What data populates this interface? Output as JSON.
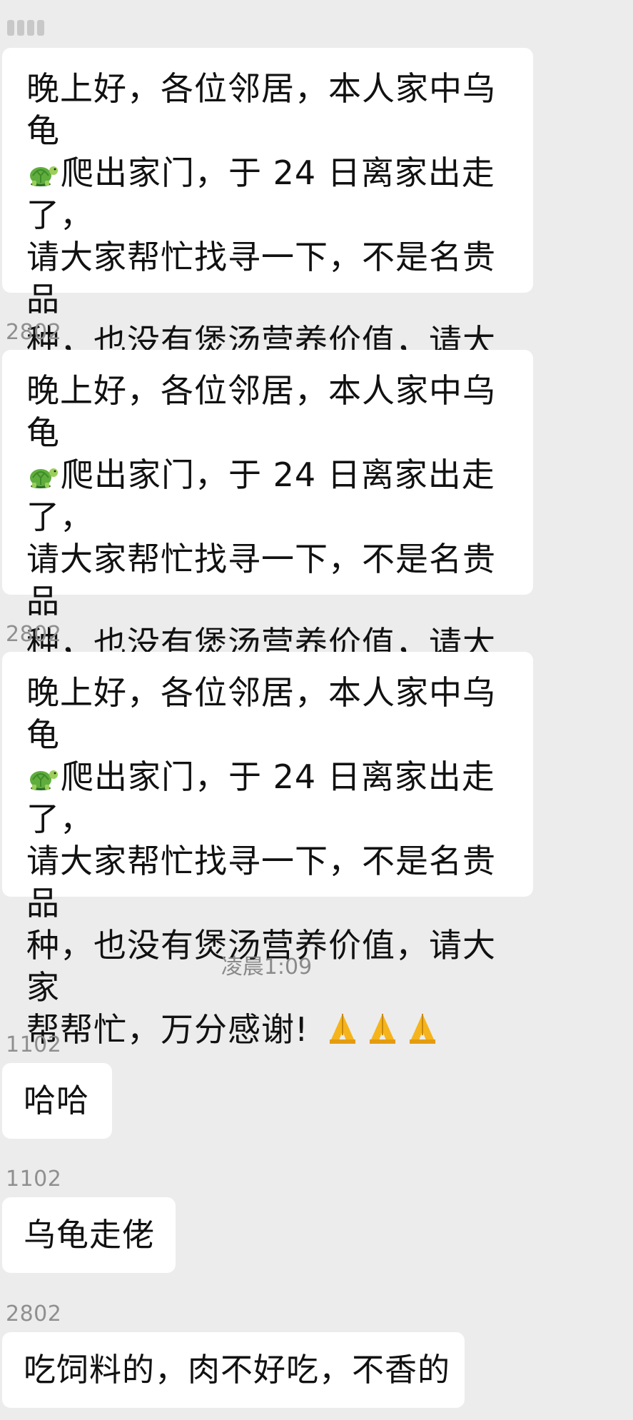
{
  "messages": [
    {
      "sender": "",
      "text_before_turtle": "晚上好，各位邻居，本人家中乌龟\n",
      "turtle_icon": "turtle-icon",
      "text_after_turtle": "爬出家门，于 24 日离家出走了，\n请大家帮忙找寻一下，不是名贵品\n种，也没有煲汤营养价值，请大家\n帮帮忙，万分感谢!",
      "trailing_icons": [
        "pray-icon",
        "pray-icon",
        "pray-icon"
      ]
    },
    {
      "sender": "2802",
      "text_before_turtle": "晚上好，各位邻居，本人家中乌龟\n",
      "turtle_icon": "turtle-icon",
      "text_after_turtle": "爬出家门，于 24 日离家出走了，\n请大家帮忙找寻一下，不是名贵品\n种，也没有煲汤营养价值，请大家\n帮帮忙，万分感谢!",
      "trailing_icons": [
        "pray-icon",
        "pray-icon",
        "pray-icon"
      ]
    },
    {
      "sender": "2802",
      "text_before_turtle": "晚上好，各位邻居，本人家中乌龟\n",
      "turtle_icon": "turtle-icon",
      "text_after_turtle": "爬出家门，于 24 日离家出走了，\n请大家帮忙找寻一下，不是名贵品\n种，也没有煲汤营养价值，请大家\n帮帮忙，万分感谢!",
      "trailing_icons": [
        "pray-icon",
        "pray-icon",
        "pray-icon"
      ]
    },
    {
      "sender": "1102",
      "text": "哈哈"
    },
    {
      "sender": "1102",
      "text": "乌龟走佬"
    },
    {
      "sender": "2802",
      "text": "吃饲料的，肉不好吃，不香的"
    }
  ],
  "timestamp": "凌晨1:09",
  "colors": {
    "background": "#ececec",
    "bubble": "#ffffff",
    "text": "#111111",
    "meta_text": "#8f8f8f",
    "emoji_skin": "#f5b41c"
  }
}
